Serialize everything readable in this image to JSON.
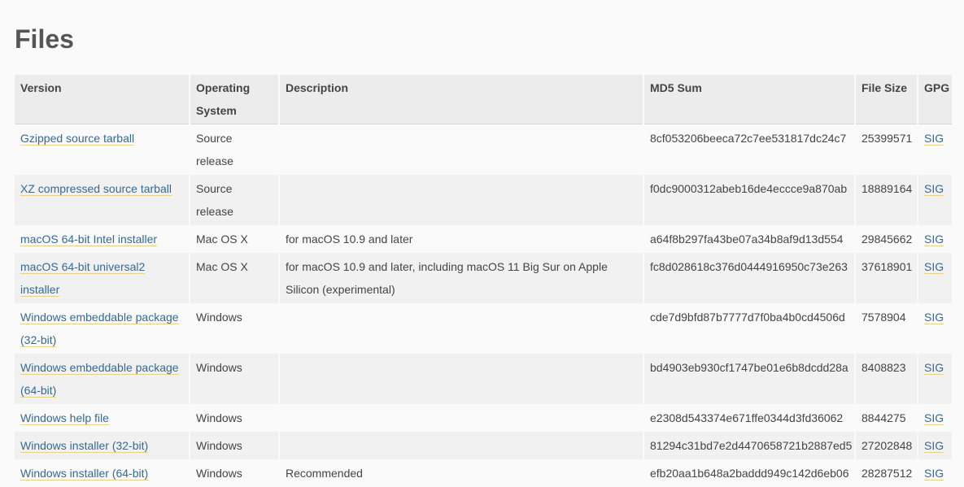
{
  "page_title": "Files",
  "table": {
    "headers": {
      "version": "Version",
      "os": "Operating System",
      "description": "Description",
      "md5": "MD5 Sum",
      "size": "File Size",
      "gpg": "GPG"
    },
    "rows": [
      {
        "version": "Gzipped source tarball",
        "os": "Source release",
        "description": "",
        "md5": "8cf053206beeca72c7ee531817dc24c7",
        "size": "25399571",
        "gpg": "SIG"
      },
      {
        "version": "XZ compressed source tarball",
        "os": "Source release",
        "description": "",
        "md5": "f0dc9000312abeb16de4eccce9a870ab",
        "size": "18889164",
        "gpg": "SIG"
      },
      {
        "version": "macOS 64-bit Intel installer",
        "os": "Mac OS X",
        "description": "for macOS 10.9 and later",
        "md5": "a64f8b297fa43be07a34b8af9d13d554",
        "size": "29845662",
        "gpg": "SIG"
      },
      {
        "version": "macOS 64-bit universal2 installer",
        "os": "Mac OS X",
        "description": "for macOS 10.9 and later, including macOS 11 Big Sur on Apple Silicon (experimental)",
        "md5": "fc8d028618c376d0444916950c73e263",
        "size": "37618901",
        "gpg": "SIG"
      },
      {
        "version": "Windows embeddable package (32-bit)",
        "os": "Windows",
        "description": "",
        "md5": "cde7d9bfd87b7777d7f0ba4b0cd4506d",
        "size": "7578904",
        "gpg": "SIG"
      },
      {
        "version": "Windows embeddable package (64-bit)",
        "os": "Windows",
        "description": "",
        "md5": "bd4903eb930cf1747be01e6b8dcdd28a",
        "size": "8408823",
        "gpg": "SIG"
      },
      {
        "version": "Windows help file",
        "os": "Windows",
        "description": "",
        "md5": "e2308d543374e671ffe0344d3fd36062",
        "size": "8844275",
        "gpg": "SIG"
      },
      {
        "version": "Windows installer (32-bit)",
        "os": "Windows",
        "description": "",
        "md5": "81294c31bd7e2d4470658721b2887ed5",
        "size": "27202848",
        "gpg": "SIG"
      },
      {
        "version": "Windows installer (64-bit)",
        "os": "Windows",
        "description": "Recommended",
        "md5": "efb20aa1b648a2baddd949c142d6eb06",
        "size": "28287512",
        "gpg": "SIG"
      }
    ]
  }
}
